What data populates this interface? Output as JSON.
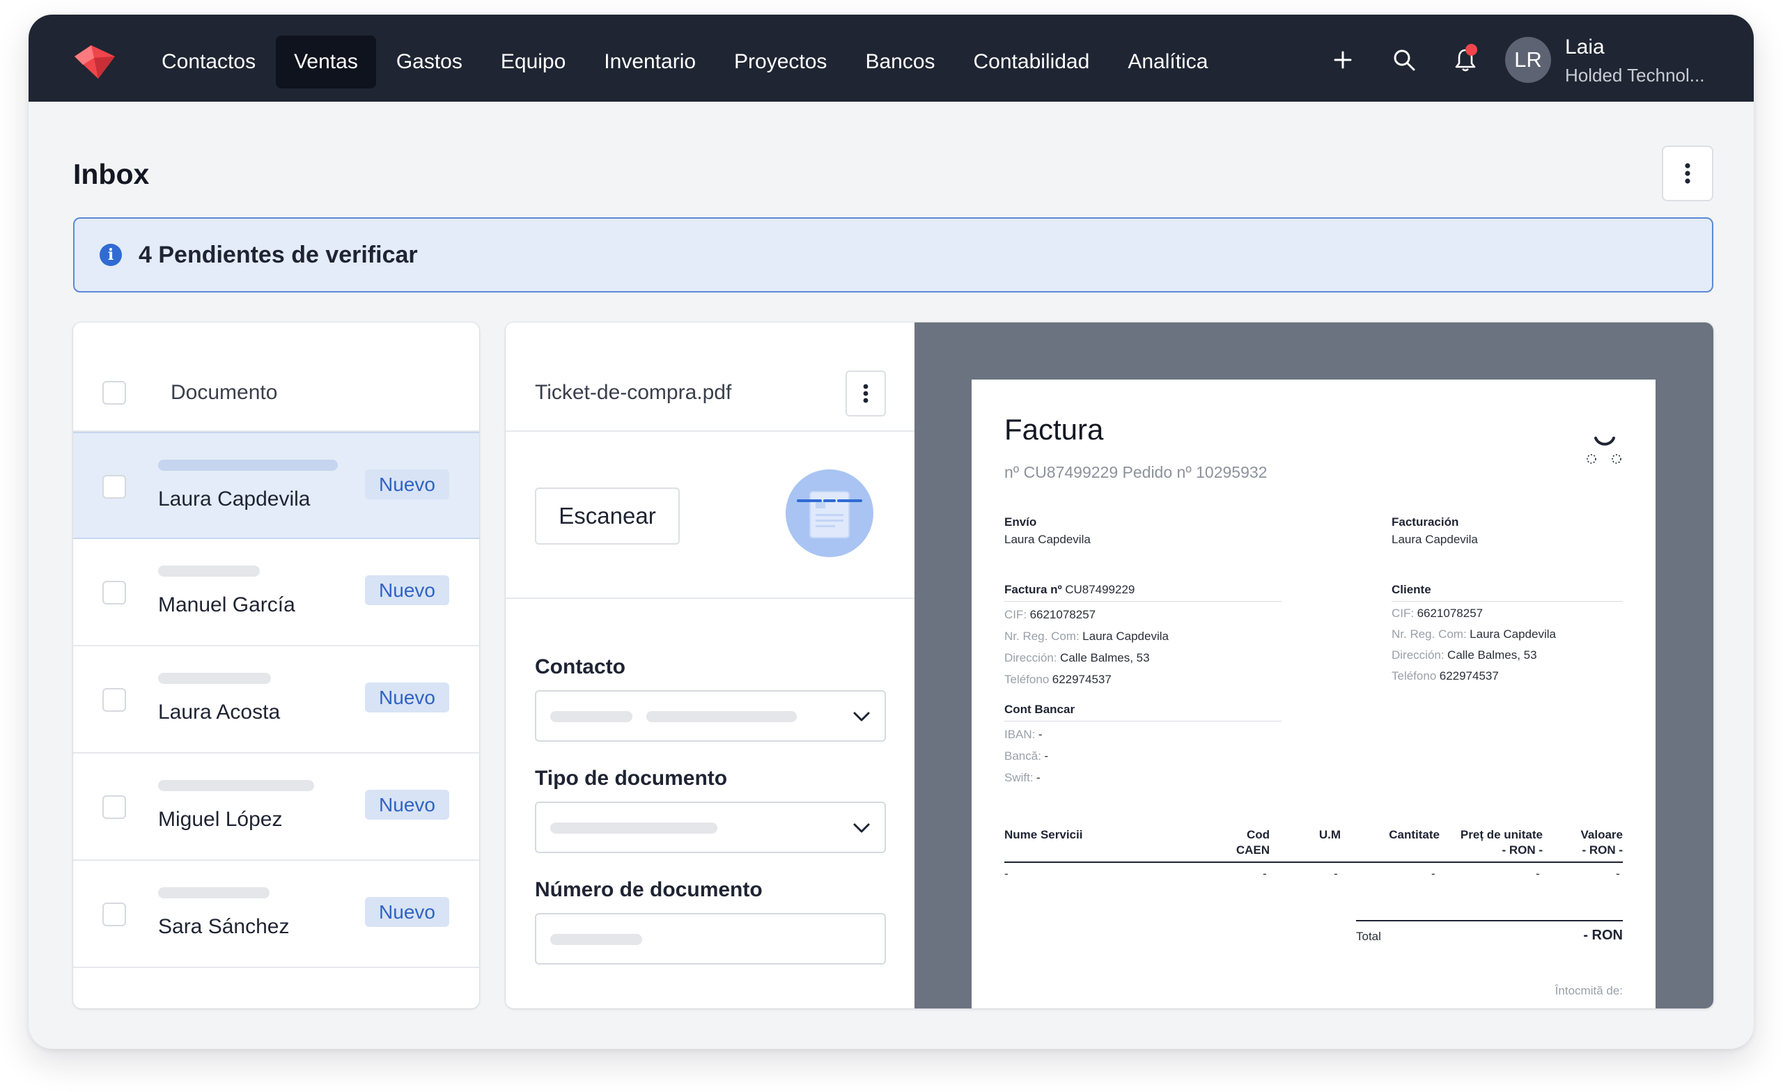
{
  "nav": {
    "items": [
      {
        "label": "Contactos",
        "active": false
      },
      {
        "label": "Ventas",
        "active": true
      },
      {
        "label": "Gastos",
        "active": false
      },
      {
        "label": "Equipo",
        "active": false
      },
      {
        "label": "Inventario",
        "active": false
      },
      {
        "label": "Proyectos",
        "active": false
      },
      {
        "label": "Bancos",
        "active": false
      },
      {
        "label": "Contabilidad",
        "active": false
      },
      {
        "label": "Analítica",
        "active": false
      }
    ],
    "icons": [
      "plus-icon",
      "search-icon",
      "bell-icon"
    ],
    "user": {
      "initials": "LR",
      "name": "Laia",
      "company": "Holded Technol..."
    }
  },
  "page": {
    "title": "Inbox",
    "banner": "4 Pendientes de verificar"
  },
  "list": {
    "header": "Documento",
    "rows": [
      {
        "name": "Laura Capdevila",
        "badge": "Nuevo",
        "selected": true
      },
      {
        "name": "Manuel García",
        "badge": "Nuevo",
        "selected": false
      },
      {
        "name": "Laura Acosta",
        "badge": "Nuevo",
        "selected": false
      },
      {
        "name": "Miguel López",
        "badge": "Nuevo",
        "selected": false
      },
      {
        "name": "Sara Sánchez",
        "badge": "Nuevo",
        "selected": false
      }
    ]
  },
  "form": {
    "file_name": "Ticket-de-compra.pdf",
    "scan_label": "Escanear",
    "contact_label": "Contacto",
    "doc_type_label": "Tipo de documento",
    "doc_number_label": "Número de documento"
  },
  "invoice": {
    "title": "Factura",
    "subtitle": "nº CU87499229 Pedido nº 10295932",
    "shipping": {
      "label": "Envío",
      "name": "Laura Capdevila"
    },
    "billing": {
      "label": "Facturación",
      "name": "Laura Capdevila"
    },
    "invoice_no": {
      "label": "Factura nº",
      "value": "CU87499229"
    },
    "client_label": "Cliente",
    "left_fields": [
      {
        "key": "CIF:",
        "value": "6621078257"
      },
      {
        "key": "Nr. Reg. Com:",
        "value": "Laura Capdevila"
      },
      {
        "key": "Dirección:",
        "value": "Calle Balmes, 53"
      },
      {
        "key": "Teléfono",
        "value": "622974537"
      }
    ],
    "right_fields": [
      {
        "key": "CIF:",
        "value": "6621078257"
      },
      {
        "key": "Nr. Reg. Com:",
        "value": "Laura Capdevila"
      },
      {
        "key": "Dirección:",
        "value": "Calle Balmes, 53"
      },
      {
        "key": "Teléfono",
        "value": "622974537"
      }
    ],
    "bank": {
      "label": "Cont Bancar",
      "fields": [
        {
          "key": "IBAN:",
          "value": "-"
        },
        {
          "key": "Bancă:",
          "value": "-"
        },
        {
          "key": "Swift:",
          "value": "-"
        }
      ]
    },
    "table": {
      "headers": {
        "service": "Nume Servicii",
        "cod_1": "Cod",
        "cod_2": "CAEN",
        "um": "U.M",
        "qty": "Cantitate",
        "price_1": "Preț de unitate",
        "price_2": "- RON -",
        "value_1": "Valoare",
        "value_2": "- RON -"
      },
      "row": [
        "-",
        "-",
        "-",
        "-",
        "-",
        "-"
      ]
    },
    "total_label": "Total",
    "total_value": "- RON",
    "footer": "Întocmită de:"
  },
  "colors": {
    "nav_bg": "#1f2532",
    "accent": "#2f6bd2",
    "badge_text": "#2f63c4",
    "badge_bg": "#d8e3f5",
    "notification": "#f0454b",
    "logo": "#f0454b"
  }
}
